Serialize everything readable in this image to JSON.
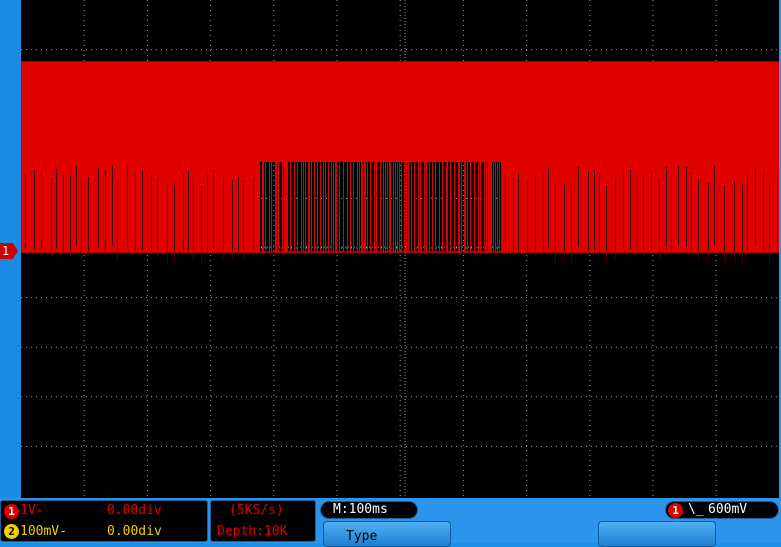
{
  "channels": [
    {
      "number": "1",
      "scale": "1V-",
      "offset": "0.00div",
      "color": "#e00000"
    },
    {
      "number": "2",
      "scale": "100mV-",
      "offset": "0.00div",
      "color": "#f0d000"
    }
  ],
  "acquisition": {
    "sample_rate": "(5KS/s)",
    "depth": "Depth:10K"
  },
  "timebase": {
    "label": "M:100ms"
  },
  "trigger": {
    "channel": "1",
    "edge_glyph": "\\_",
    "level": "600mV"
  },
  "channel_marker": "1",
  "menu": {
    "button_label": "Type"
  },
  "colors": {
    "trace": "#e00000",
    "grid": "#9a9a9a",
    "panel": "#2a95ea"
  }
}
